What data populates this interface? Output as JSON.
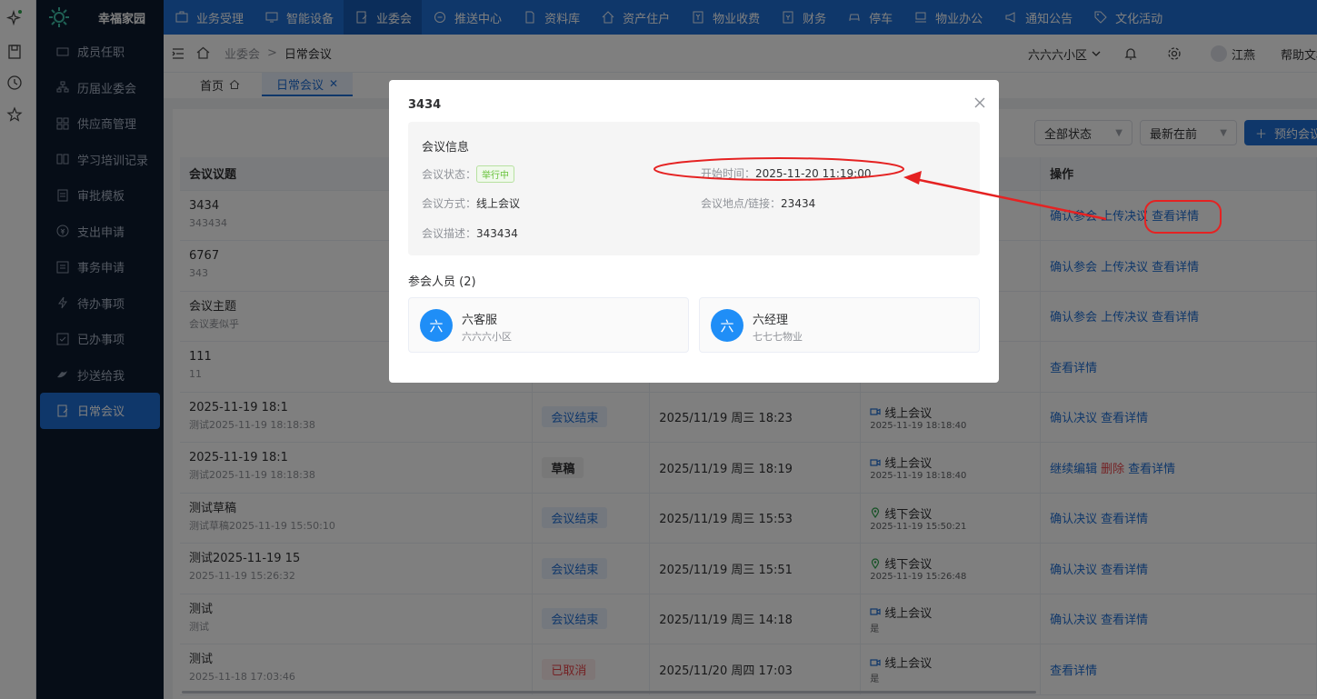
{
  "brand": {
    "name": "幸福家园"
  },
  "topnav": [
    {
      "label": "业务受理",
      "icon": "briefcase-icon"
    },
    {
      "label": "智能设备",
      "icon": "monitor-icon"
    },
    {
      "label": "业委会",
      "icon": "document-icon",
      "active": true
    },
    {
      "label": "推送中心",
      "icon": "chat-icon"
    },
    {
      "label": "资料库",
      "icon": "file-icon"
    },
    {
      "label": "资产住户",
      "icon": "home-icon"
    },
    {
      "label": "物业收费",
      "icon": "receipt-icon"
    },
    {
      "label": "财务",
      "icon": "finance-icon"
    },
    {
      "label": "停车",
      "icon": "car-icon"
    },
    {
      "label": "物业办公",
      "icon": "laptop-icon"
    },
    {
      "label": "通知公告",
      "icon": "megaphone-icon"
    },
    {
      "label": "文化活动",
      "icon": "tag-icon"
    }
  ],
  "sidebar": {
    "items": [
      {
        "label": "成员任职"
      },
      {
        "label": "历届业委会"
      },
      {
        "label": "供应商管理"
      },
      {
        "label": "学习培训记录"
      },
      {
        "label": "审批模板"
      },
      {
        "label": "支出申请"
      },
      {
        "label": "事务申请"
      },
      {
        "label": "待办事项"
      },
      {
        "label": "已办事项"
      },
      {
        "label": "抄送给我"
      },
      {
        "label": "日常会议",
        "active": true
      }
    ]
  },
  "header": {
    "breadcrumb_parent": "业委会",
    "breadcrumb_sep": ">",
    "breadcrumb_current": "日常会议",
    "community": "六六六小区",
    "user": "江燕",
    "help": "帮助文档"
  },
  "tabs": {
    "home": "首页",
    "current": "日常会议"
  },
  "toolbar": {
    "status_filter": "全部状态",
    "sort": "最新在前",
    "book_button": "预约会议"
  },
  "table": {
    "headers": {
      "title": "会议议题",
      "ops": "操作"
    },
    "rows": [
      {
        "title": "3434",
        "sub": "343434",
        "status": "",
        "time": "",
        "mode": "",
        "mode_sub": "",
        "ops": [
          "确认参会",
          "上传决议",
          "查看详情"
        ]
      },
      {
        "title": "6767",
        "sub": "343",
        "status": "",
        "time": "",
        "mode": "",
        "mode_sub": "",
        "ops": [
          "确认参会",
          "上传决议",
          "查看详情"
        ]
      },
      {
        "title": "会议主题",
        "sub": "会议麦似乎",
        "status": "",
        "time": "",
        "mode": "",
        "mode_sub": "",
        "ops": [
          "确认参会",
          "上传决议",
          "查看详情"
        ]
      },
      {
        "title": "111",
        "sub": "11",
        "status": "",
        "time": "",
        "mode": "",
        "mode_sub": "",
        "ops": [
          "查看详情"
        ]
      },
      {
        "title": "2025-11-19 18:1",
        "sub": "测试2025-11-19 18:18:38",
        "status": "会议结束",
        "status_type": "ended",
        "time": "2025/11/19 周三 18:23",
        "mode": "线上会议",
        "mode_type": "online",
        "mode_sub": "2025-11-19 18:18:40",
        "ops": [
          "确认决议",
          "查看详情"
        ]
      },
      {
        "title": "2025-11-19 18:1",
        "sub": "测试2025-11-19 18:18:38",
        "status": "草稿",
        "status_type": "draft",
        "time": "2025/11/19 周三 18:19",
        "mode": "线上会议",
        "mode_type": "online",
        "mode_sub": "2025-11-19 18:18:40",
        "ops": [
          "继续编辑",
          "删除",
          "查看详情"
        ]
      },
      {
        "title": "测试草稿",
        "sub": "测试草稿2025-11-19 15:50:10",
        "status": "会议结束",
        "status_type": "ended",
        "time": "2025/11/19 周三 15:53",
        "mode": "线下会议",
        "mode_type": "offline",
        "mode_sub": "2025-11-19 15:50:21",
        "ops": [
          "确认决议",
          "查看详情"
        ]
      },
      {
        "title": "测试2025-11-19 15",
        "sub": "2025-11-19 15:26:32",
        "status": "会议结束",
        "status_type": "ended",
        "time": "2025/11/19 周三 15:51",
        "mode": "线下会议",
        "mode_type": "offline",
        "mode_sub": "2025-11-19 15:26:48",
        "ops": [
          "确认决议",
          "查看详情"
        ]
      },
      {
        "title": "测试",
        "sub": "测试",
        "status": "会议结束",
        "status_type": "ended",
        "time": "2025/11/19 周三 14:18",
        "mode": "线上会议",
        "mode_type": "online",
        "mode_sub": "是",
        "ops": [
          "确认决议",
          "查看详情"
        ]
      },
      {
        "title": "测试",
        "sub": "2025-11-18 17:03:46",
        "status": "已取消",
        "status_type": "cancel",
        "time": "2025/11/20 周四 17:03",
        "mode": "线上会议",
        "mode_type": "online",
        "mode_sub": "是",
        "ops": [
          "查看详情"
        ]
      }
    ]
  },
  "modal": {
    "title": "3434",
    "info_heading": "会议信息",
    "status_label": "会议状态：",
    "status_value": "举行中",
    "start_label": "开始时间：",
    "start_value": "2025-11-20 11:19:00",
    "mode_label": "会议方式：",
    "mode_value": "线上会议",
    "location_label": "会议地点/链接：",
    "location_value": "23434",
    "desc_label": "会议描述：",
    "desc_value": "343434",
    "attendees_label": "参会人员",
    "attendees_count": "(2)",
    "attendees": [
      {
        "avatar": "六",
        "name": "六客服",
        "org": "六六六小区"
      },
      {
        "avatar": "六",
        "name": "六经理",
        "org": "七七七物业"
      }
    ]
  },
  "colors": {
    "primary": "#1f6ed4",
    "sidebar_bg": "#0c1a2e",
    "annotation": "#e52222"
  }
}
